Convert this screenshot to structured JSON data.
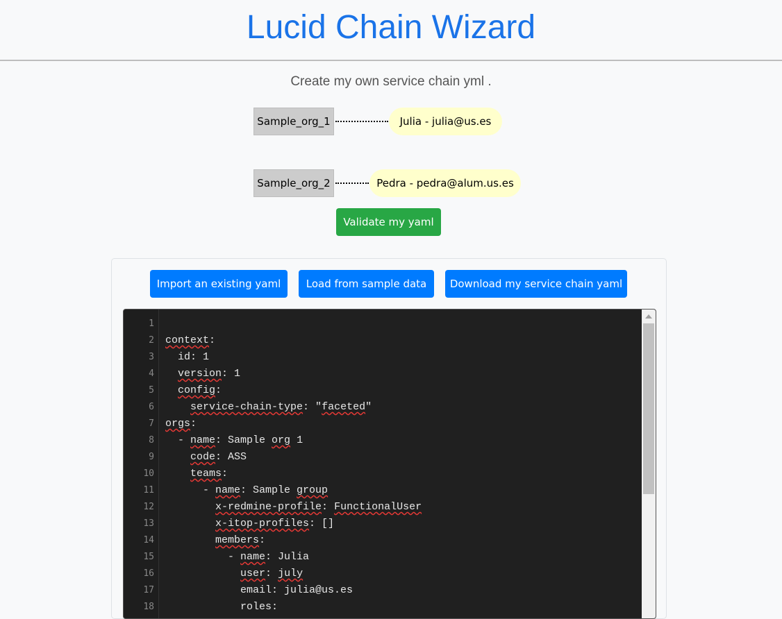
{
  "header": {
    "title": "Lucid Chain Wizard"
  },
  "subtitle": "Create my own service chain yml .",
  "graph": {
    "orgs": [
      {
        "label": "Sample_org_1",
        "member": "Julia - julia@us.es"
      },
      {
        "label": "Sample_org_2",
        "member": "Pedra - pedra@alum.us.es"
      }
    ]
  },
  "buttons": {
    "validate": "Validate my yaml",
    "import": "Import an existing yaml",
    "load_sample": "Load from sample data",
    "download": "Download my service chain yaml"
  },
  "editor": {
    "line_numbers": [
      "1",
      "2",
      "3",
      "4",
      "5",
      "6",
      "7",
      "8",
      "9",
      "10",
      "11",
      "12",
      "13",
      "14",
      "15",
      "16",
      "17",
      "18"
    ],
    "lines": [
      [],
      [
        {
          "t": "context",
          "sq": true
        },
        {
          "t": ":"
        }
      ],
      [
        {
          "t": "  id: 1"
        }
      ],
      [
        {
          "t": "  "
        },
        {
          "t": "version",
          "sq": true
        },
        {
          "t": ": 1"
        }
      ],
      [
        {
          "t": "  "
        },
        {
          "t": "config",
          "sq": true
        },
        {
          "t": ":"
        }
      ],
      [
        {
          "t": "    "
        },
        {
          "t": "service-chain-type",
          "sq": true
        },
        {
          "t": ": \""
        },
        {
          "t": "faceted",
          "sq": true
        },
        {
          "t": "\""
        }
      ],
      [
        {
          "t": "orgs",
          "sq": true
        },
        {
          "t": ":"
        }
      ],
      [
        {
          "t": "  - "
        },
        {
          "t": "name",
          "sq": true
        },
        {
          "t": ": Sample "
        },
        {
          "t": "org",
          "sq": true
        },
        {
          "t": " 1"
        }
      ],
      [
        {
          "t": "    "
        },
        {
          "t": "code",
          "sq": true
        },
        {
          "t": ": ASS"
        }
      ],
      [
        {
          "t": "    "
        },
        {
          "t": "teams",
          "sq": true
        },
        {
          "t": ":"
        }
      ],
      [
        {
          "t": "      - "
        },
        {
          "t": "name",
          "sq": true
        },
        {
          "t": ": Sample "
        },
        {
          "t": "group",
          "sq": true
        }
      ],
      [
        {
          "t": "        "
        },
        {
          "t": "x-redmine-profile",
          "sq": true
        },
        {
          "t": ": "
        },
        {
          "t": "FunctionalUser",
          "sq": true
        }
      ],
      [
        {
          "t": "        "
        },
        {
          "t": "x-itop-profiles",
          "sq": true
        },
        {
          "t": ": []"
        }
      ],
      [
        {
          "t": "        "
        },
        {
          "t": "members",
          "sq": true
        },
        {
          "t": ":"
        }
      ],
      [
        {
          "t": "          - "
        },
        {
          "t": "name",
          "sq": true
        },
        {
          "t": ": Julia"
        }
      ],
      [
        {
          "t": "            "
        },
        {
          "t": "user",
          "sq": true
        },
        {
          "t": ": "
        },
        {
          "t": "july",
          "sq": true
        }
      ],
      [
        {
          "t": "            email: julia@us.es"
        }
      ],
      [
        {
          "t": "            roles:"
        }
      ]
    ]
  }
}
